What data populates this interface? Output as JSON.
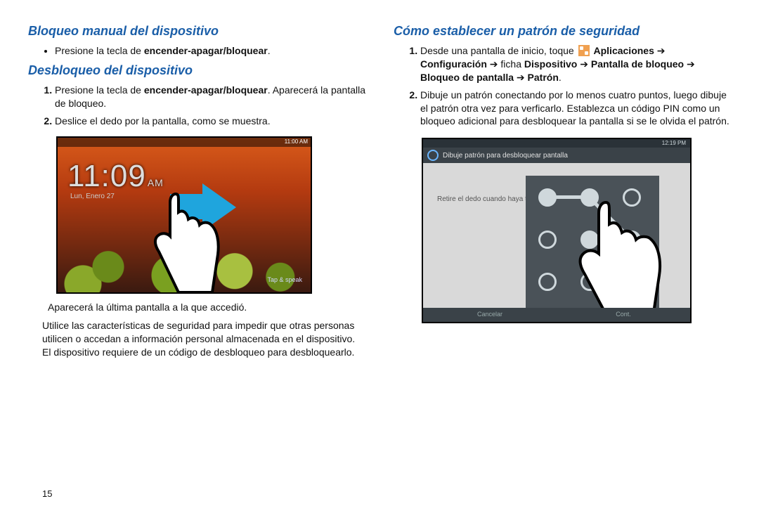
{
  "left": {
    "h_lock": "Bloqueo manual del dispositivo",
    "bullet_prefix": "Presione la tecla de ",
    "bullet_bold": "encender-apagar/bloquear",
    "h_unlock": "Desbloqueo del dispositivo",
    "step1_prefix": "Presione la tecla de ",
    "step1_bold": "encender-apagar/bloquear",
    "step1_tail": ". Aparecerá la pantalla de bloqueo.",
    "step2": "Deslice el dedo por la pantalla, como se muestra.",
    "after1": "Aparecerá la última pantalla a la que accedió.",
    "after2": "Utilice las características de seguridad para impedir que otras personas utilicen o accedan a información personal almacenada en el dispositivo. El dispositivo requiere de un código de desbloqueo para desbloquearlo.",
    "lockscreen": {
      "status_time": "11:00 AM",
      "clock": "11:09",
      "ampm": "AM",
      "date": "Lun, Enero 27",
      "shortcut": "Tap &\nspeak"
    }
  },
  "right": {
    "h_pattern": "Cómo establecer un patrón de seguridad",
    "step1_a": "Desde una pantalla de inicio, toque ",
    "step1_apps": "Aplicaciones",
    "step1_config": "Configuración",
    "step1_fichalabel": " ficha ",
    "step1_dispositivo": "Dispositivo",
    "step1_pantbloq": "Pantalla de bloqueo",
    "step1_bloqpant": "Bloqueo de pantalla",
    "step1_patron": "Patrón",
    "step2": "Dibuje un patrón conectando por lo menos cuatro puntos, luego dibuje el patrón otra vez para verficarlo. Establezca un código PIN como un bloqueo adicional para desbloquear la pantalla si se le olvida el patrón.",
    "pattern": {
      "status_time": "12:19 PM",
      "title": "Dibuje patrón para desbloquear pantalla",
      "hint": "Retire el dedo cuando haya terminado",
      "btn_cancel": "Cancelar",
      "btn_cont": "Cont."
    }
  },
  "pagenum": "15"
}
